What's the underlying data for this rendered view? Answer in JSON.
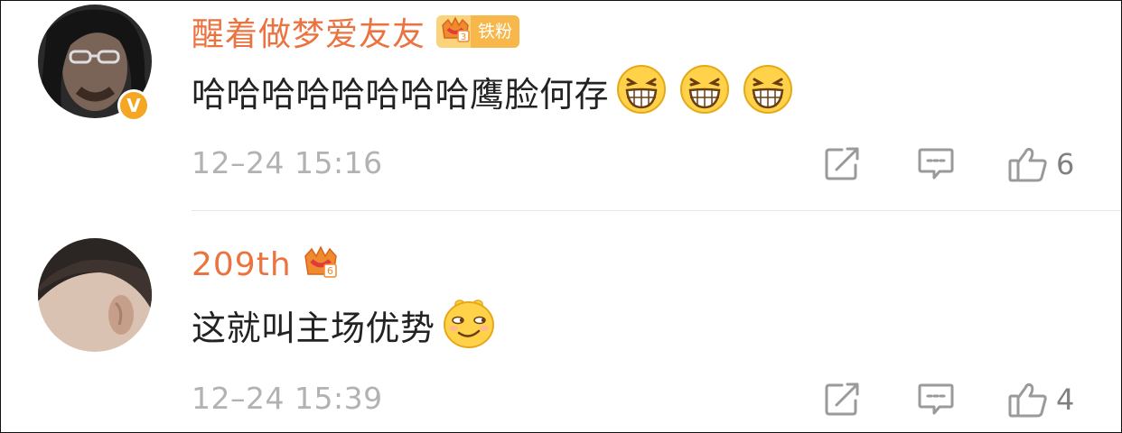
{
  "comments": [
    {
      "username": "醒着做梦爱友友",
      "fan_badge": "铁粉",
      "verified": true,
      "verified_mark": "V",
      "text": "哈哈哈哈哈哈哈哈鹰脸何存",
      "emojis": [
        "grin-emoji",
        "grin-emoji",
        "grin-emoji"
      ],
      "timestamp": "12–24 15:16",
      "likes": "6"
    },
    {
      "username": "209th",
      "text": "这就叫主场优势",
      "emojis": [
        "smirk-emoji"
      ],
      "timestamp": "12–24 15:39",
      "likes": "4"
    }
  ],
  "colors": {
    "username": "#eb7340",
    "content": "#222222",
    "meta": "#b2b2b2",
    "badge": "#f5a623",
    "icon": "#9a9a9a"
  },
  "icons": {
    "share": "share-icon",
    "reply": "comment-icon",
    "like": "thumbs-up-icon"
  }
}
